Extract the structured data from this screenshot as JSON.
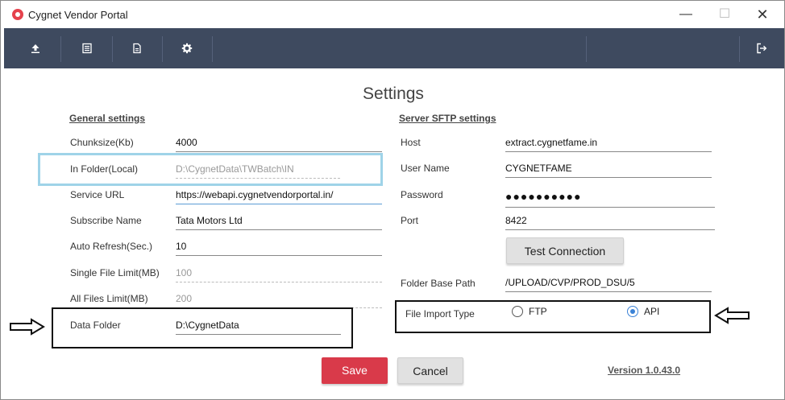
{
  "window": {
    "title": "Cygnet Vendor Portal",
    "minimize_glyph": "—",
    "maximize_glyph": "☐",
    "close_glyph": "✕"
  },
  "toolbar": {
    "buttons": [
      {
        "name": "upload-icon"
      },
      {
        "name": "list-icon"
      },
      {
        "name": "document-icon"
      },
      {
        "name": "gear-icon"
      }
    ],
    "logout_icon": "logout-icon",
    "background": "#3e4a5f"
  },
  "page": {
    "title": "Settings"
  },
  "general": {
    "title": "General settings",
    "chunksize": {
      "label": "Chunksize(Kb)",
      "value": "4000"
    },
    "in_folder": {
      "label": "In Folder(Local)",
      "value": "D:\\CygnetData\\TWBatch\\IN"
    },
    "service_url": {
      "label": "Service URL",
      "value": "https://webapi.cygnetvendorportal.in/"
    },
    "subscribe_name": {
      "label": "Subscribe Name",
      "value": "Tata Motors Ltd"
    },
    "auto_refresh": {
      "label": "Auto Refresh(Sec.)",
      "value": "10"
    },
    "single_file_limit": {
      "label": "Single File Limit(MB)",
      "value": "100"
    },
    "all_files_limit": {
      "label": "All Files Limit(MB)",
      "value": "200"
    },
    "data_folder": {
      "label": "Data Folder",
      "value": "D:\\CygnetData"
    }
  },
  "sftp": {
    "title": "Server SFTP settings",
    "host": {
      "label": "Host",
      "value": "extract.cygnetfame.in"
    },
    "user_name": {
      "label": "User Name",
      "value": "CYGNETFAME"
    },
    "password": {
      "label": "Password",
      "value": "●●●●●●●●●●"
    },
    "port": {
      "label": "Port",
      "value": "8422"
    },
    "test_connection": "Test Connection",
    "folder_base_path": {
      "label": "Folder Base Path",
      "value": "/UPLOAD/CVP/PROD_DSU/5"
    },
    "file_import_type": {
      "label": "File Import Type",
      "options": [
        "FTP",
        "API"
      ],
      "selected": "API"
    }
  },
  "actions": {
    "save": "Save",
    "cancel": "Cancel"
  },
  "version": "Version 1.0.43.0",
  "colors": {
    "save": "#d93a4a",
    "radio_selected": "#3b82d6",
    "highlight_box": "#9fd3e8"
  }
}
